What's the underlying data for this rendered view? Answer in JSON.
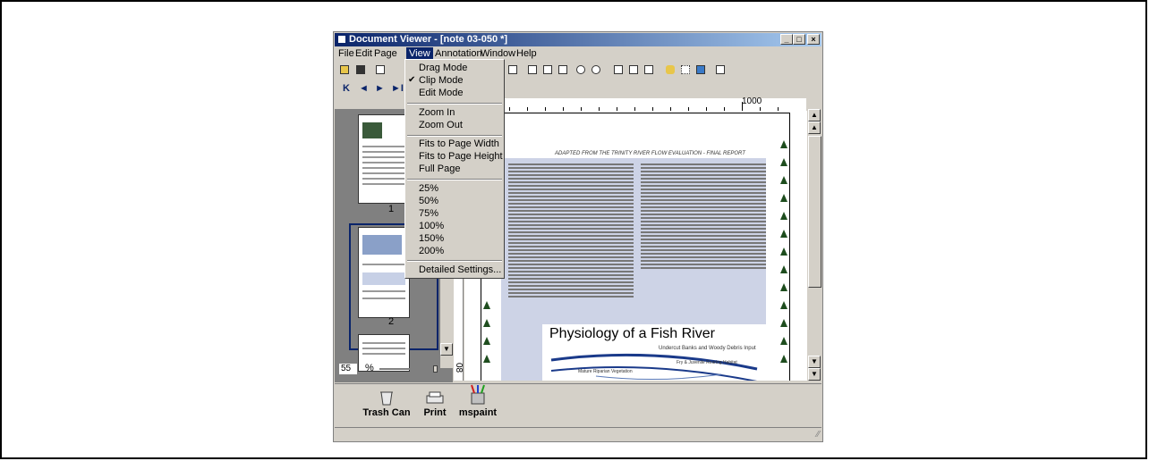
{
  "window": {
    "title": "Document Viewer - [note 03-050 *]",
    "buttons": [
      "_",
      "□",
      "×"
    ]
  },
  "menubar": [
    "File",
    "Edit",
    "Page",
    "View",
    "Annotation",
    "Window",
    "Help"
  ],
  "view_menu": {
    "items": [
      {
        "label": "Drag Mode",
        "checked": false
      },
      {
        "label": "Clip Mode",
        "checked": true
      },
      {
        "label": "Edit Mode",
        "checked": false
      },
      {
        "label": "Zoom In"
      },
      {
        "label": "Zoom Out"
      },
      {
        "label": "Fits to Page Width"
      },
      {
        "label": "Fits to Page Height"
      },
      {
        "label": "Full Page"
      },
      {
        "label": "25%"
      },
      {
        "label": "50%"
      },
      {
        "label": "75%"
      },
      {
        "label": "100%"
      },
      {
        "label": "150%"
      },
      {
        "label": "200%"
      },
      {
        "label": "Detailed Settings..."
      }
    ],
    "check_glyph": "✔"
  },
  "nav": {
    "first": "K",
    "prev": "◄",
    "next": "►",
    "last": "►I"
  },
  "thumbnails": [
    {
      "label": "1"
    },
    {
      "label": "2"
    }
  ],
  "zoom": {
    "value": "55",
    "unit": "%"
  },
  "ruler": {
    "top_label": "1000",
    "left_label": "08"
  },
  "document": {
    "header": "ADAPTED FROM THE TRINITY RIVER FLOW EVALUATION - FINAL REPORT",
    "figure_title": "Physiology of a Fish River",
    "figure_subtitle": "Undercut Banks and Woody Debris Input",
    "figure_labels": [
      "Fry & Juvenile Rearing Habitat",
      "Mature Riparian Vegetation"
    ]
  },
  "bottom_icons": [
    {
      "label": "Trash Can",
      "icon": "trash-can-icon"
    },
    {
      "label": "Print",
      "icon": "printer-icon"
    },
    {
      "label": "mspaint",
      "icon": "paint-icon"
    }
  ]
}
